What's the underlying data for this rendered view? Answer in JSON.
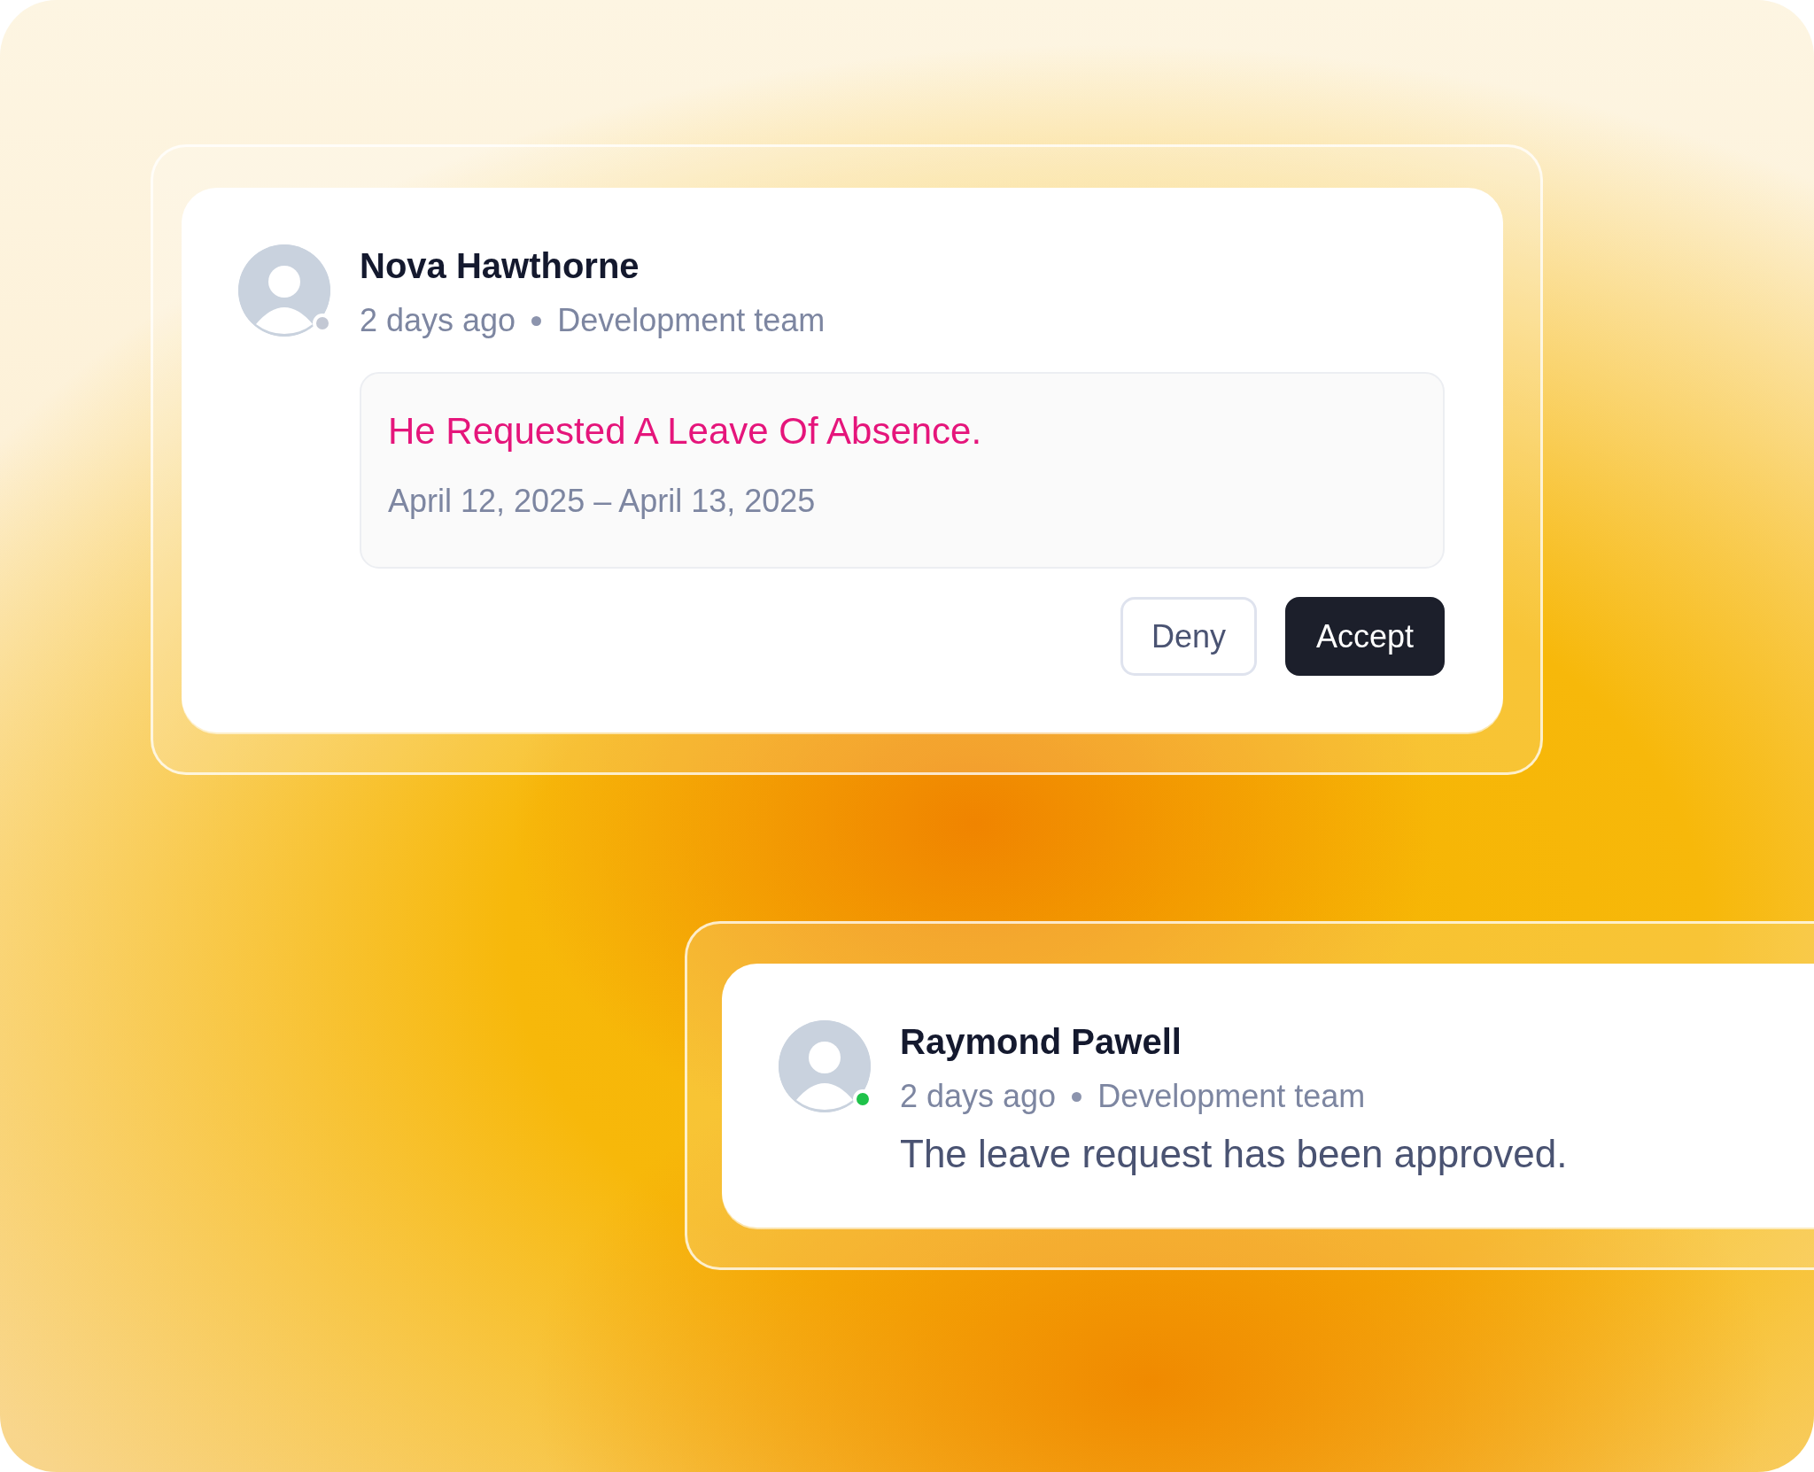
{
  "cards": [
    {
      "kind": "request",
      "name": "Nova Hawthorne",
      "online": false,
      "time": "2 days ago",
      "team": "Development team",
      "request": {
        "title": "He Requested A Leave Of Absence.",
        "dates": "April 12, 2025 – April 13, 2025"
      },
      "buttons": [
        {
          "label": "Deny",
          "kind": "secondary"
        },
        {
          "label": "Accept",
          "kind": "primary"
        }
      ]
    },
    {
      "kind": "update",
      "name": "Raymond Pawell",
      "online": true,
      "time": "2 days ago",
      "team": "Development team",
      "message": "The leave request has been approved."
    }
  ]
}
